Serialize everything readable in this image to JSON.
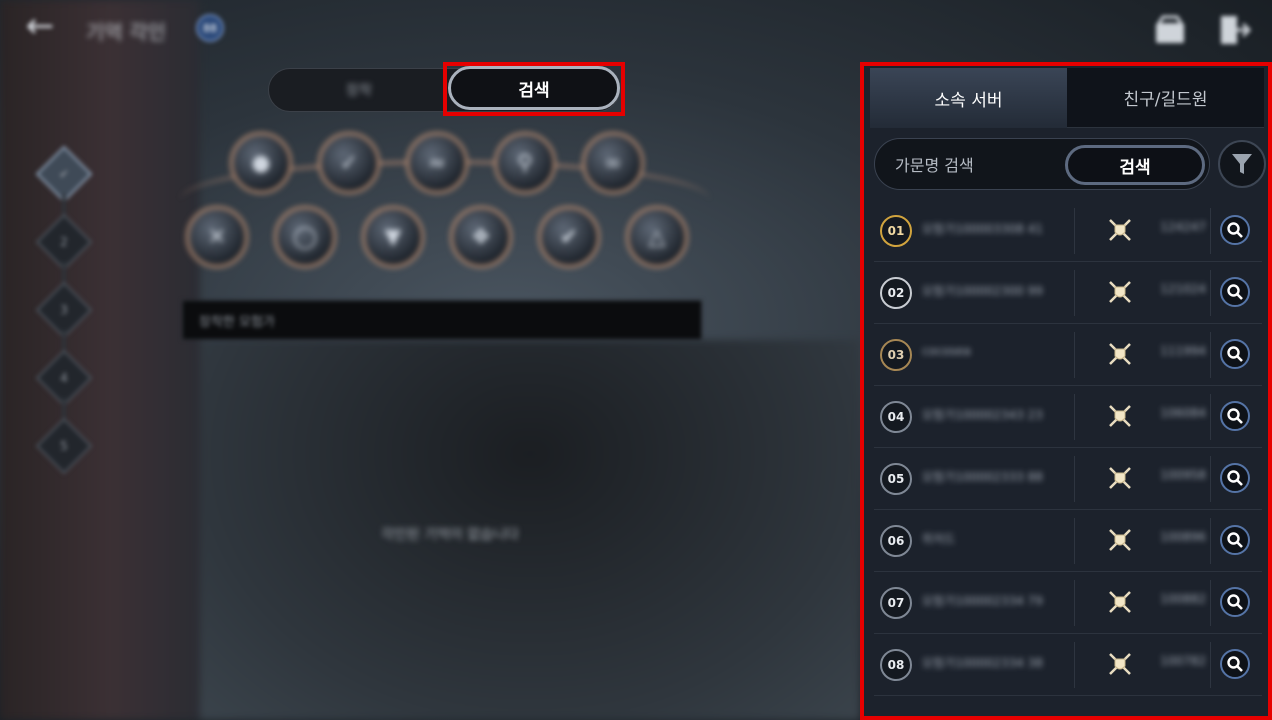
{
  "header": {
    "title": "기억 각인",
    "badge": "88",
    "back_icon": "arrow-left-icon",
    "right_icons": [
      "mailbox-icon",
      "exit-door-icon"
    ]
  },
  "mode_toggle": {
    "left_label": "장착",
    "right_label": "검색",
    "selected": "검색"
  },
  "slots": [
    "1",
    "2",
    "3",
    "4",
    "5"
  ],
  "search_bar": {
    "label": "장착한 모험가"
  },
  "empty_message": "각인된 기억이 없습니다",
  "panel": {
    "tabs": [
      {
        "label": "소속 서버",
        "active": true
      },
      {
        "label": "친구/길드원",
        "active": false
      }
    ],
    "sub_toggle": {
      "left_label": "가문명 검색",
      "right_label": "검색"
    },
    "filter_icon": "funnel-icon",
    "rows": [
      {
        "rank": "01",
        "name": "모험가100003308 41",
        "score": "124247",
        "medal": "gold"
      },
      {
        "rank": "02",
        "name": "모험가100002300 99",
        "score": "121024",
        "medal": "silver"
      },
      {
        "rank": "03",
        "name": "cocosea",
        "score": "111994",
        "medal": "bronze"
      },
      {
        "rank": "04",
        "name": "모험가100002343 23",
        "score": "106084",
        "medal": "none"
      },
      {
        "rank": "05",
        "name": "모험가100002333 88",
        "score": "100958",
        "medal": "none"
      },
      {
        "rank": "06",
        "name": "위저드",
        "score": "100896",
        "medal": "none"
      },
      {
        "rank": "07",
        "name": "모험가100002334 79",
        "score": "100882",
        "medal": "none"
      },
      {
        "rank": "08",
        "name": "모험가100002334 38",
        "score": "100782",
        "medal": "none"
      }
    ]
  },
  "colors": {
    "highlight": "#e60000",
    "panel_bg": "#1c222c",
    "accent_blue": "#5574a6",
    "gold": "#d1a43e"
  }
}
